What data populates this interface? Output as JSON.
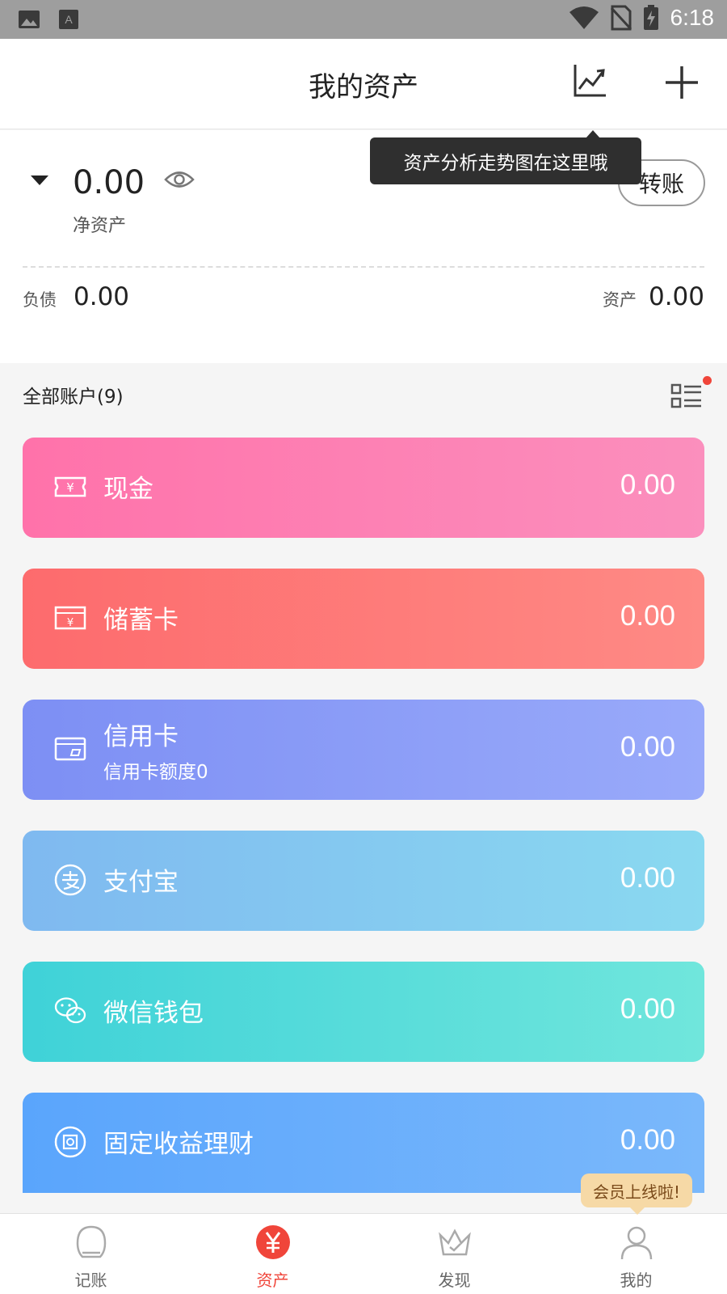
{
  "status_bar": {
    "time": "6:18"
  },
  "header": {
    "title": "我的资产"
  },
  "tooltip": {
    "text": "资产分析走势图在这里哦"
  },
  "summary": {
    "net_value": "0.00",
    "net_label": "净资产",
    "transfer_label": "转账",
    "liabilities_label": "负债",
    "liabilities_value": "0.00",
    "assets_label": "资产",
    "assets_value": "0.00"
  },
  "accounts": {
    "title": "全部账户(9)",
    "items": [
      {
        "name": "现金",
        "value": "0.00",
        "icon": "cash-icon"
      },
      {
        "name": "储蓄卡",
        "value": "0.00",
        "icon": "debit-card-icon"
      },
      {
        "name": "信用卡",
        "sub": "信用卡额度0",
        "value": "0.00",
        "icon": "credit-card-icon"
      },
      {
        "name": "支付宝",
        "value": "0.00",
        "icon": "alipay-icon"
      },
      {
        "name": "微信钱包",
        "value": "0.00",
        "icon": "wechat-icon"
      },
      {
        "name": "固定收益理财",
        "value": "0.00",
        "icon": "fixed-income-icon"
      }
    ]
  },
  "member_badge": {
    "text": "会员上线啦!"
  },
  "nav": {
    "items": [
      {
        "label": "记账"
      },
      {
        "label": "资产"
      },
      {
        "label": "发现"
      },
      {
        "label": "我的"
      }
    ]
  },
  "colors": {
    "accent": "#f0453a",
    "tooltip_bg": "#2f2f2f",
    "badge_bg": "#f6d9a6"
  }
}
